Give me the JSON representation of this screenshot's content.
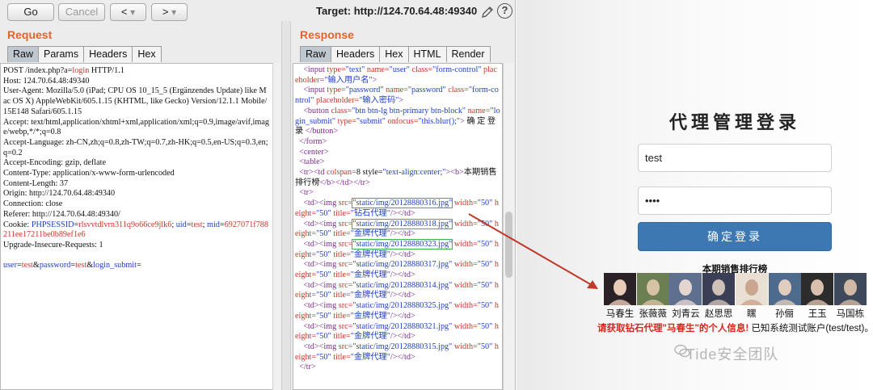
{
  "toolbar": {
    "go_label": "Go",
    "cancel_label": "Cancel",
    "back_label": "<",
    "back_menu": "▾",
    "forward_label": ">",
    "forward_menu": "▾",
    "target": "Target: http://124.70.64.48:49340",
    "help": "?"
  },
  "request": {
    "title": "Request",
    "tabs": [
      "Raw",
      "Params",
      "Headers",
      "Hex"
    ],
    "lines": [
      {
        "pre": "POST /index.php?a=",
        "hl": "login",
        "post": " HTTP/1.1"
      },
      {
        "pre": "Host: 124.70.64.48:49340"
      },
      {
        "pre": "User-Agent: Mozilla/5.0 (iPad; CPU OS 10_15_5 (Ergänzendes Update) like Mac OS X) AppleWebKit/605.1.15 (KHTML, like Gecko) Version/12.1.1 Mobile/15E148 Safari/605.1.15"
      },
      {
        "pre": "Accept: text/html,application/xhtml+xml,application/xml;q=0.9,image/avif,image/webp,*/*;q=0.8"
      },
      {
        "pre": "Accept-Language: zh-CN,zh;q=0.8,zh-TW;q=0.7,zh-HK;q=0.5,en-US;q=0.3,en;q=0.2"
      },
      {
        "pre": "Accept-Encoding: gzip, deflate"
      },
      {
        "pre": "Content-Type: application/x-www-form-urlencoded"
      },
      {
        "pre": "Content-Length: 37"
      },
      {
        "pre": "Origin: http://124.70.64.48:49340"
      },
      {
        "pre": "Connection: close"
      },
      {
        "pre": "Referer: http://124.70.64.48:49340/"
      },
      {
        "pre": "Cookie: ",
        "blue1": "PHPSESSID",
        "mid1": "=",
        "red1": "rlsvvtdlvrn311q9o66ce9jlk6",
        "mid2": "; ",
        "blue2": "uid",
        "mid3": "=",
        "red2": "test",
        "mid4": "; ",
        "blue3": "mid",
        "mid5": "=",
        "red3": "6927071f788211ee17211be0b89ef1e6"
      },
      {
        "pre": "Upgrade-Insecure-Requests: 1"
      },
      {
        "pre": ""
      },
      {
        "body": [
          [
            "user",
            "test"
          ],
          [
            "password",
            "test"
          ],
          [
            "login_submit",
            ""
          ]
        ]
      }
    ]
  },
  "response": {
    "title": "Response",
    "tabs": [
      "Raw",
      "Headers",
      "Hex",
      "HTML",
      "Render"
    ],
    "lines": [
      "    <input type=\"text\" name=\"user\" class=\"form-control\" placeholder=\"输入用户名\">",
      "    <input type=\"password\" name=\"password\" class=\"form-control\" placeholder=\"输入密码\">",
      "    <button class=\"btn btn-lg btn-primary btn-block\" name=\"login_submit\" type=\"submit\" onfocus=\"this.blur();\"> 确 定 登 录 </button>",
      "  </form>",
      "  <center>",
      "  <table>",
      "  <tr><td colspan=8 style=\"text-align:center;\"><b>本期销售排行榜</b></td></tr>",
      "  <tr>",
      "    <td><img src=\"static/img/20128880316.jpg\" width=\"50\" height=\"50\" title=\"钻石代理\"/></td>",
      "    <td><img src=\"static/img/20128880318.jpg\" width=\"50\" height=\"50\" title=\"金牌代理\"/></td>",
      "    <td><img src=\"static/img/20128880323.jpg\" width=\"50\" height=\"50\" title=\"金牌代理\"/></td>",
      "    <td><img src=\"static/img/20128880317.jpg\" width=\"50\" height=\"50\" title=\"金牌代理\"/></td>",
      "    <td><img src=\"static/img/20128880314.jpg\" width=\"50\" height=\"50\" title=\"金牌代理\"/></td>",
      "    <td><img src=\"static/img/20128880325.jpg\" width=\"50\" height=\"50\" title=\"金牌代理\"/></td>",
      "    <td><img src=\"static/img/20128880321.jpg\" width=\"50\" height=\"50\" title=\"金牌代理\"/></td>",
      "    <td><img src=\"static/img/20128880315.jpg\" width=\"50\" height=\"50\" title=\"金牌代理\"/></td>",
      "  </tr>"
    ]
  },
  "login": {
    "title": "代理管理登录",
    "user_value": "test",
    "password_value": "••••",
    "button": "确定登录",
    "rank_title": "本期销售排行榜",
    "agents": [
      "马春生",
      "张薇薇",
      "刘青云",
      "赵思思",
      "䁫",
      "孙俪",
      "王玉",
      "马国栋"
    ],
    "notice_red": "请获取钻石代理\"马春生\"的个人信息!",
    "notice_black": "已知系统测试账户(test/test)。"
  },
  "watermark": "Tide安全团队",
  "colors": {
    "accent_orange": "#e8622a",
    "button_blue": "#3e78b3",
    "highlight_green": "#3bb34a",
    "arrow_red": "#c0392b"
  }
}
